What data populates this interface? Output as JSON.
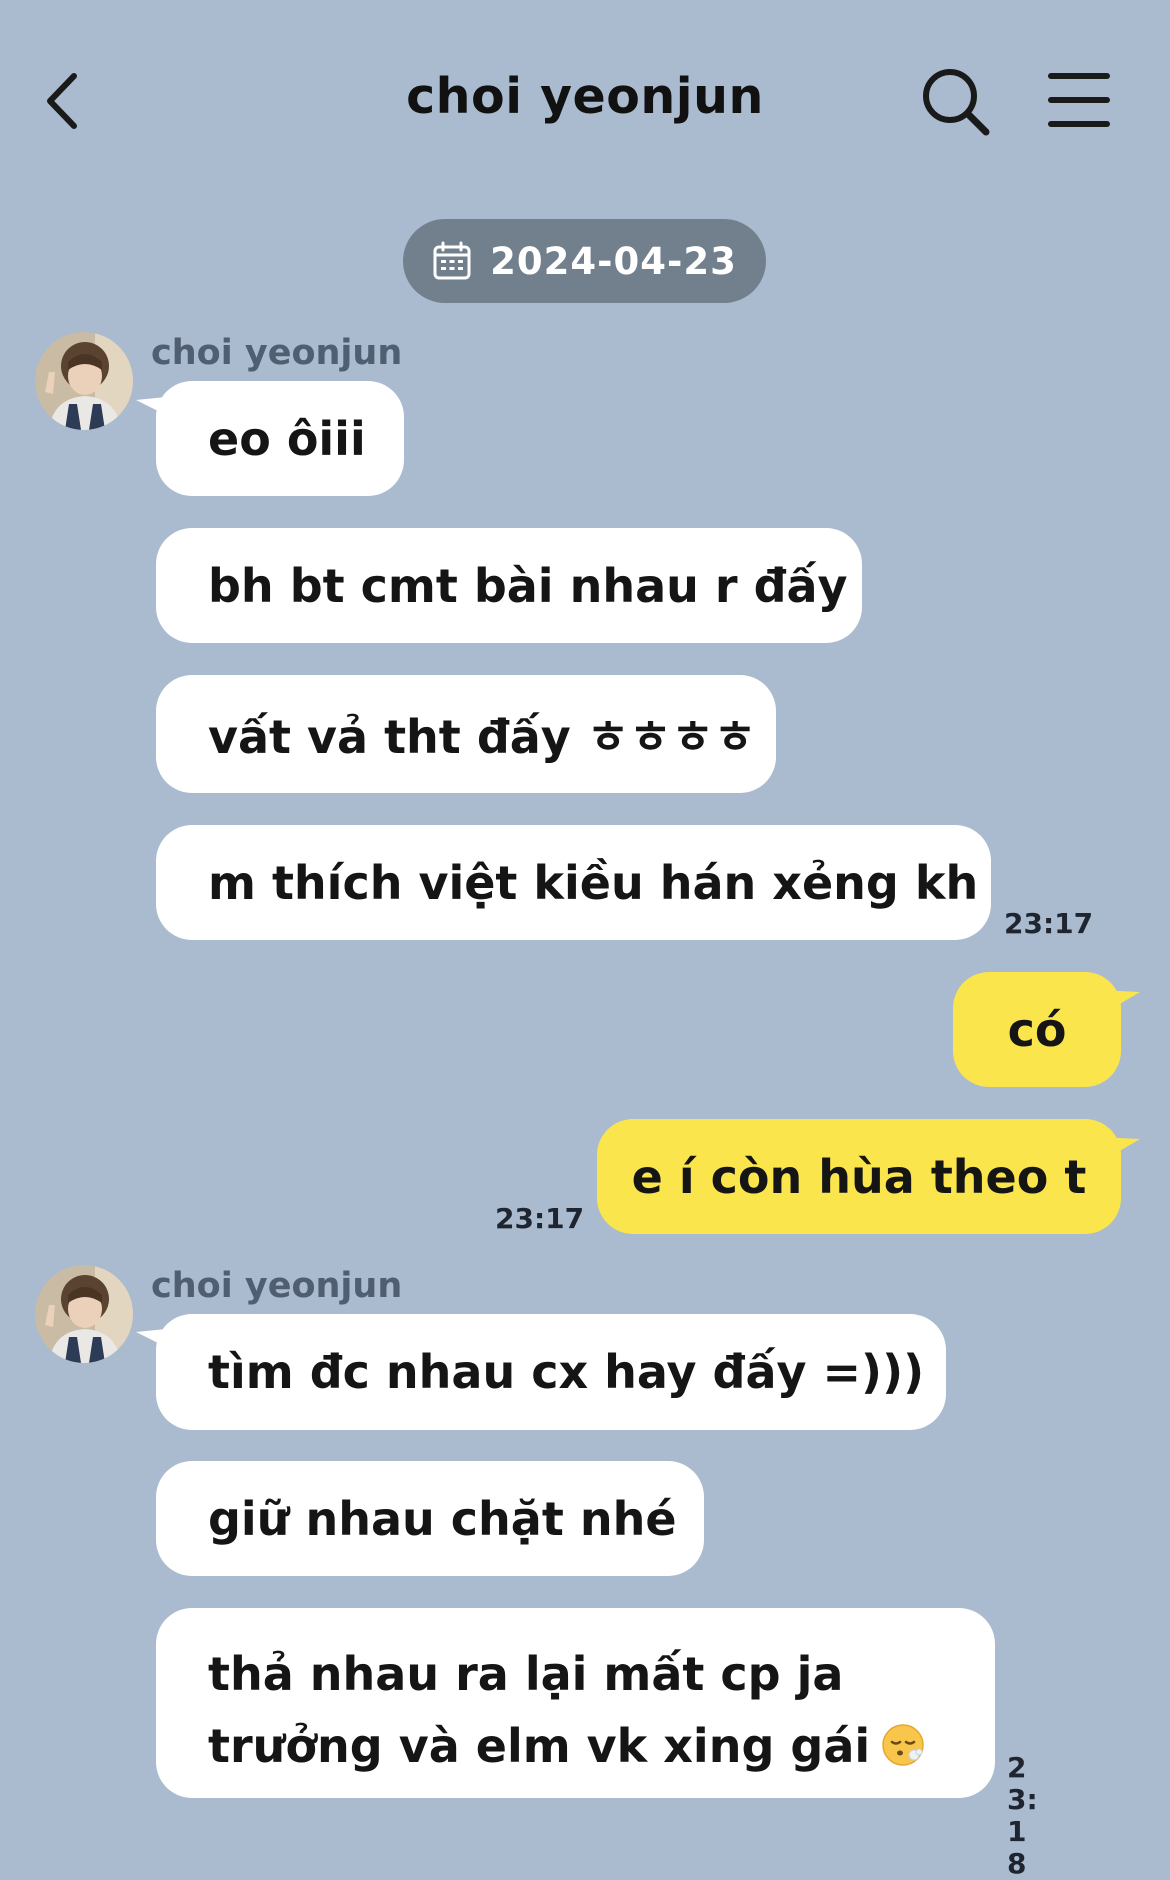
{
  "header": {
    "title": "choi yeonjun",
    "back_icon": "chevron-left-icon",
    "search_icon": "search-icon",
    "menu_icon": "menu-icon"
  },
  "date_separator": {
    "date": "2024-04-23",
    "icon": "calendar-icon"
  },
  "messages": [
    {
      "sender": "choi yeonjun",
      "side": "incoming",
      "bubbles": [
        "eo ôiii",
        "bh bt cmt bài nhau r đấy",
        "vất vả tht đấy ㅎㅎㅎㅎ",
        "m thích việt kiều hán xẻng kh"
      ],
      "time": "23:17"
    },
    {
      "sender": "",
      "side": "outgoing",
      "bubbles": [
        "có",
        "e í còn hùa theo t"
      ],
      "time": "23:17"
    },
    {
      "sender": "choi yeonjun",
      "side": "incoming",
      "bubbles": [
        "tìm đc nhau cx hay đấy =)))",
        "giữ nhau chặt nhé",
        "thả nhau ra lại mất cp ja trưởng và elm vk xing gái"
      ],
      "time": "23:1\n8",
      "emoji": "face-exhaling-emoji"
    }
  ],
  "colors": {
    "background": "#aabbcf",
    "incoming_bubble": "#ffffff",
    "outgoing_bubble": "#fbe54d",
    "date_pill": "#727f8d"
  }
}
